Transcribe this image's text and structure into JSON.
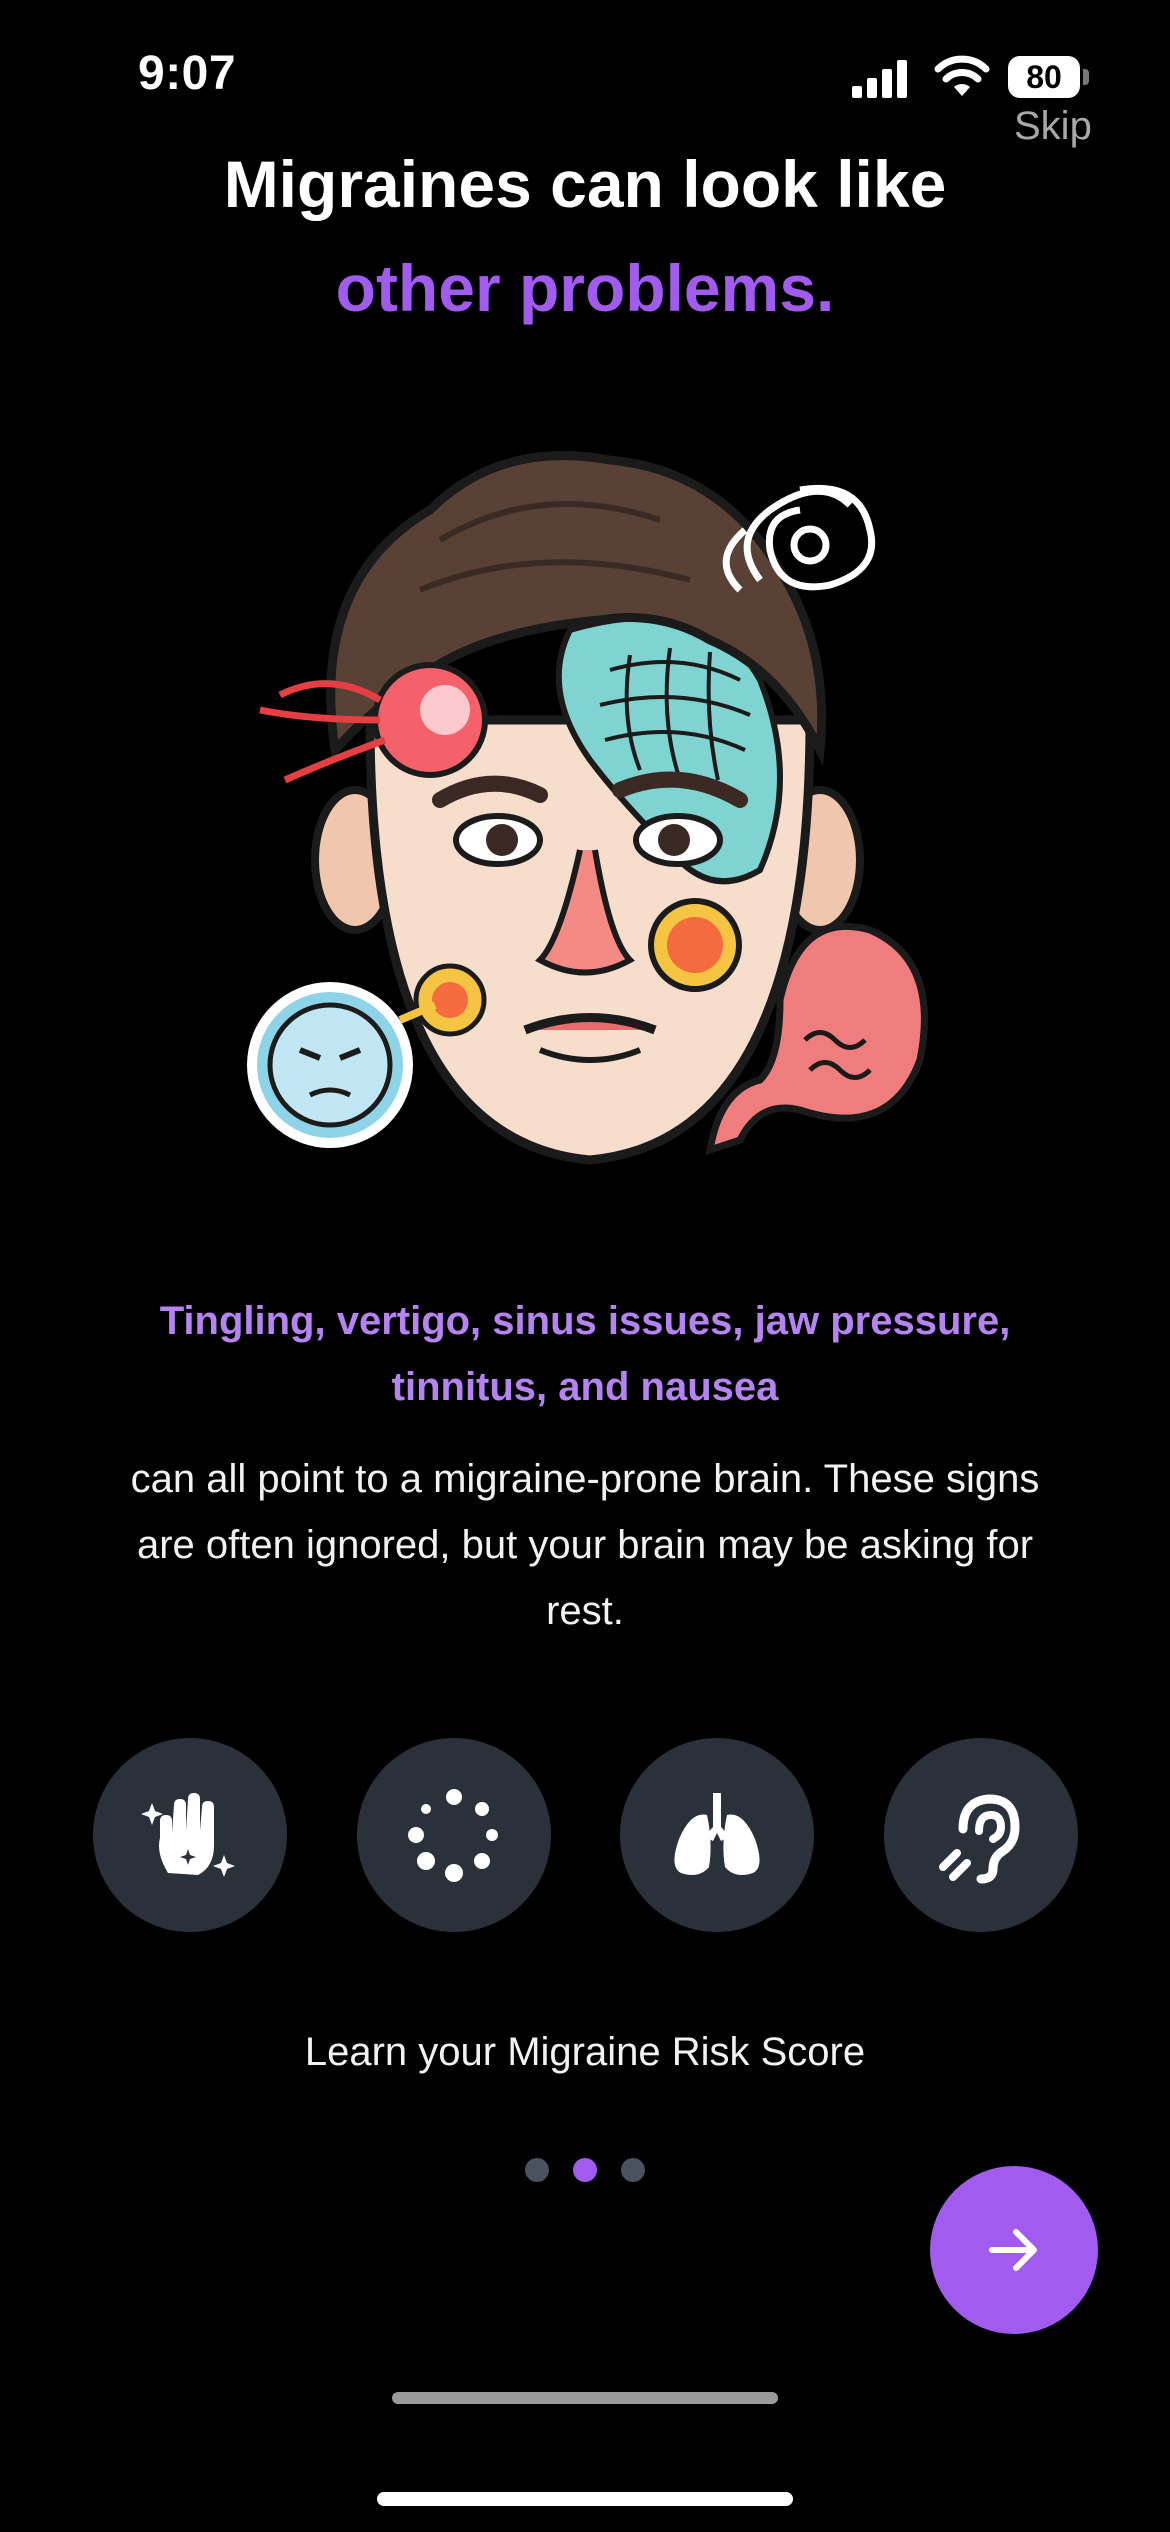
{
  "status_bar": {
    "time": "9:07",
    "battery": "80"
  },
  "skip_label": "Skip",
  "title": {
    "line1": "Migraines can look like",
    "line2": "other problems.",
    "accent_color": "#a15bef"
  },
  "illustration": {
    "subject": "cartoon man's face with migraine symptoms: head pain, vertigo swirl, sinus grid, jaw pressure, stomach"
  },
  "symptoms_highlight": "Tingling, vertigo, sinus issues, jaw pressure, tinnitus, and nausea",
  "body_text": "can all point to a migraine-prone brain. These signs are often ignored, but your brain may be asking for rest.",
  "symptom_icons": [
    {
      "name": "tingling-hand-icon"
    },
    {
      "name": "vertigo-dots-icon"
    },
    {
      "name": "lungs-icon"
    },
    {
      "name": "ear-icon"
    }
  ],
  "cta_text": "Learn your Migraine Risk Score",
  "pagination": {
    "count": 3,
    "active_index": 1
  },
  "next_button": {
    "icon": "arrow-right-icon",
    "color": "#a15bef"
  }
}
